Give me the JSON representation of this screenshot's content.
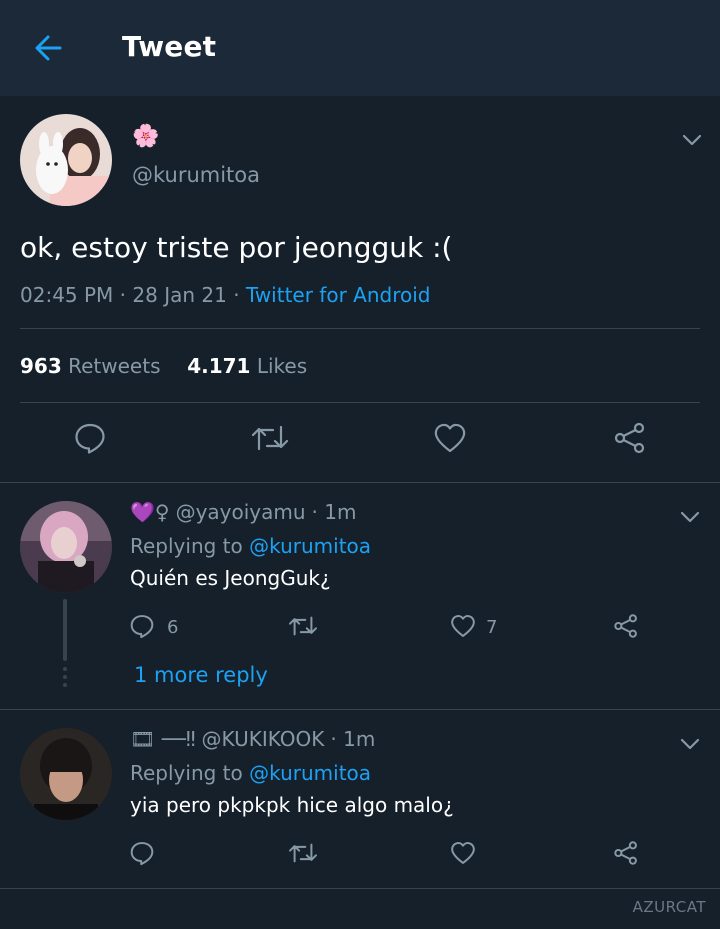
{
  "header": {
    "title": "Tweet"
  },
  "tweet": {
    "display_name": "🌸",
    "handle": "@kurumitoa",
    "text": "ok, estoy triste por jeongguk :(",
    "time": "02:45 PM",
    "date": "28 Jan 21",
    "source": "Twitter for Android",
    "retweets_count": "963",
    "retweets_label": "Retweets",
    "likes_count": "4.171",
    "likes_label": "Likes"
  },
  "replies": [
    {
      "emoji": "💜♀",
      "handle": "@yayoiyamu",
      "time": "· 1m",
      "replying_prefix": "Replying to ",
      "replying_to": "@kurumitoa",
      "text": "Quién es JeongGuk¿",
      "reply_count": "6",
      "like_count": "7",
      "more_replies": "1 more reply"
    },
    {
      "emoji": "🎞 ──‼",
      "handle": "@KUKIKOOK",
      "time": "· 1m",
      "replying_prefix": "Replying to ",
      "replying_to": "@kurumitoa",
      "text": "yia pero pkpkpk hice algo malo¿"
    }
  ],
  "watermark": "AZURCAT",
  "colors": {
    "background": "#15202b",
    "header": "#1c2938",
    "accent": "#1da1f2",
    "muted": "#8899a6",
    "divider": "#38444d"
  }
}
